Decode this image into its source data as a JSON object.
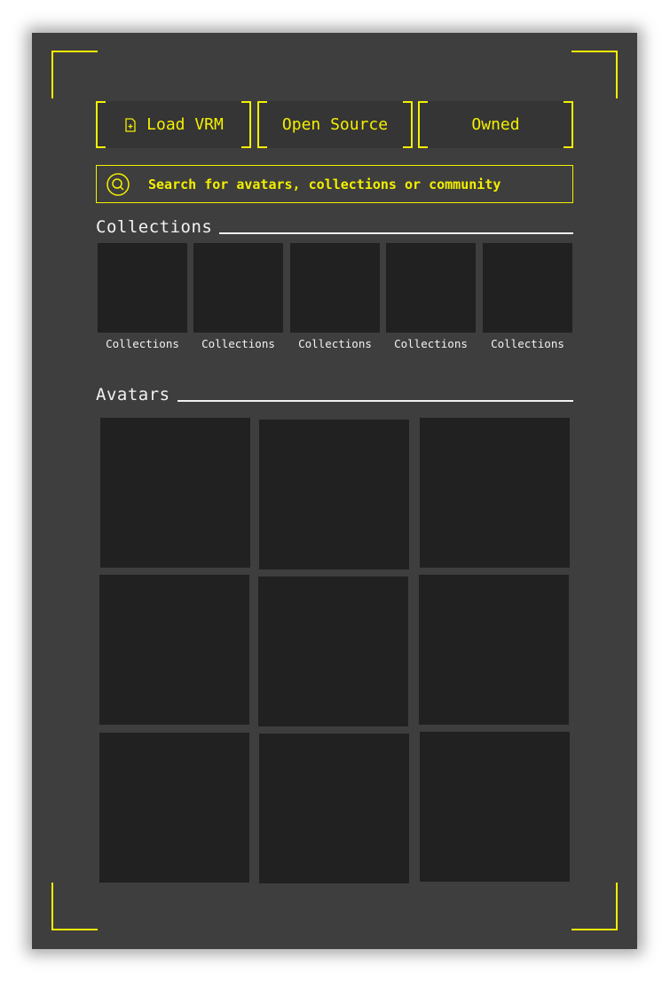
{
  "tabs": [
    {
      "label": "Load VRM",
      "icon": "file-plus-icon"
    },
    {
      "label": "Open Source"
    },
    {
      "label": "Owned"
    }
  ],
  "search": {
    "placeholder": "Search for avatars, collections or community",
    "icon": "search-icon"
  },
  "collections": {
    "title": "Collections",
    "items": [
      {
        "caption": "Collections"
      },
      {
        "caption": "Collections"
      },
      {
        "caption": "Collections"
      },
      {
        "caption": "Collections"
      },
      {
        "caption": "Collections"
      }
    ]
  },
  "avatars": {
    "title": "Avatars",
    "count": 9
  },
  "colors": {
    "accent": "#f4ef00",
    "panel": "#3e3e3e",
    "tile": "#212121",
    "text": "#f2f2f2"
  }
}
